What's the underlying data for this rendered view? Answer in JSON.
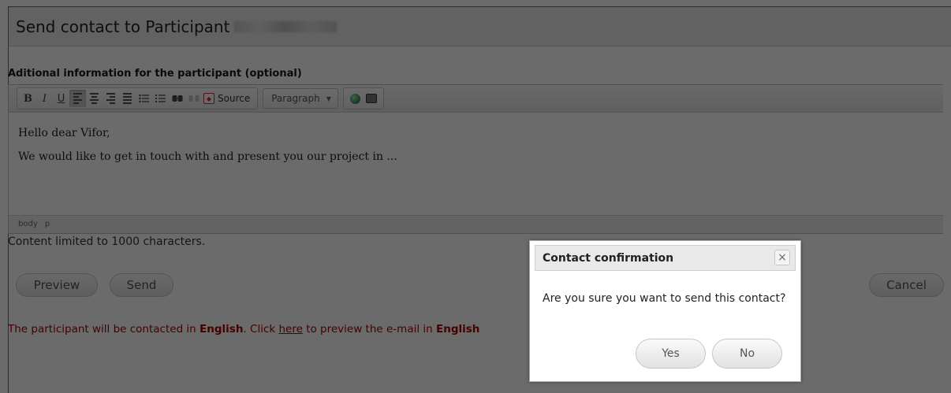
{
  "page": {
    "title": "Send contact to Participant",
    "editor_label": "Aditional information for the participant (optional)",
    "limit_text": "Content limited to 1000 characters."
  },
  "toolbar": {
    "bold_label": "B",
    "italic_label": "I",
    "underline_label": "U",
    "source_label": "Source",
    "format_value": "Paragraph"
  },
  "editor": {
    "paragraphs": [
      "Hello dear Vifor,",
      "We would like to get in touch with and present you our project in ..."
    ],
    "path": [
      "body",
      "p"
    ]
  },
  "actions": {
    "preview_label": "Preview",
    "send_label": "Send",
    "cancel_label": "Cancel"
  },
  "language_notice": {
    "prefix": "The participant will be contacted in ",
    "language": "English",
    "middle": ". Click ",
    "link_text": "here",
    "suffix": " to preview the e-mail in ",
    "language2": "English"
  },
  "dialog": {
    "title": "Contact confirmation",
    "close_glyph": "×",
    "message": "Are you sure you want to send this contact?",
    "yes_label": "Yes",
    "no_label": "No"
  },
  "icons": [
    "bold-icon",
    "italic-icon",
    "underline-icon",
    "align-left-icon",
    "align-center-icon",
    "align-right-icon",
    "align-justify-icon",
    "bulleted-list-icon",
    "numbered-list-icon",
    "link-icon",
    "unlink-icon",
    "source-icon",
    "globe-icon",
    "image-icon",
    "close-icon"
  ],
  "colors": {
    "notice_text": "#a80000",
    "overlay": "rgba(0,0,0,0.58)"
  }
}
